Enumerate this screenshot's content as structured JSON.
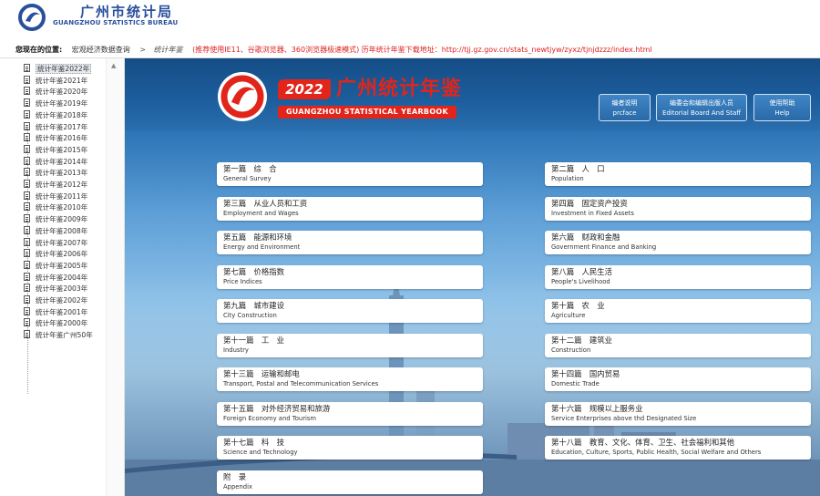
{
  "header": {
    "title": "广州市统计局",
    "subtitle": "GUANGZHOU STATISTICS BUREAU"
  },
  "breadcrumb": {
    "label": "您现在的位置:",
    "items": [
      "宏观经济数据查询",
      "统计年鉴"
    ],
    "separator": ">",
    "notice": "(推荐使用IE11、谷歌浏览器、360浏览器极速模式) 历年统计年鉴下载地址：http://tjj.gz.gov.cn/stats_newtjyw/zyxz/tjnjdzzz/index.html"
  },
  "sidebar": {
    "items": [
      {
        "label": "统计年鉴2022年",
        "selected": true
      },
      {
        "label": "统计年鉴2021年"
      },
      {
        "label": "统计年鉴2020年"
      },
      {
        "label": "统计年鉴2019年"
      },
      {
        "label": "统计年鉴2018年"
      },
      {
        "label": "统计年鉴2017年"
      },
      {
        "label": "统计年鉴2016年"
      },
      {
        "label": "统计年鉴2015年"
      },
      {
        "label": "统计年鉴2014年"
      },
      {
        "label": "统计年鉴2013年"
      },
      {
        "label": "统计年鉴2012年"
      },
      {
        "label": "统计年鉴2011年"
      },
      {
        "label": "统计年鉴2010年"
      },
      {
        "label": "统计年鉴2009年"
      },
      {
        "label": "统计年鉴2008年"
      },
      {
        "label": "统计年鉴2007年"
      },
      {
        "label": "统计年鉴2006年"
      },
      {
        "label": "统计年鉴2005年"
      },
      {
        "label": "统计年鉴2004年"
      },
      {
        "label": "统计年鉴2003年"
      },
      {
        "label": "统计年鉴2002年"
      },
      {
        "label": "统计年鉴2001年"
      },
      {
        "label": "统计年鉴2000年"
      },
      {
        "label": "统计年鉴广州50年"
      }
    ]
  },
  "banner": {
    "year": "2022",
    "title_cn": "广州统计年鉴",
    "title_en": "GUANGZHOU STATISTICAL YEARBOOK",
    "buttons": [
      {
        "cn": "编者说明",
        "en": "prcface"
      },
      {
        "cn": "编委会和编辑出版人员",
        "en": "Editorial Board And Staff"
      },
      {
        "cn": "使用帮助",
        "en": "Help"
      }
    ]
  },
  "categories": [
    {
      "cn": "第一篇　综　合",
      "en": "General Survey"
    },
    {
      "cn": "第二篇　人　口",
      "en": "Population"
    },
    {
      "cn": "第三篇　从业人员和工资",
      "en": "Employment and Wages"
    },
    {
      "cn": "第四篇　固定资产投资",
      "en": "Investment in Fixed Assets"
    },
    {
      "cn": "第五篇　能源和环境",
      "en": "Energy and Environment"
    },
    {
      "cn": "第六篇　财政和金融",
      "en": "Government Finance and Banking"
    },
    {
      "cn": "第七篇　价格指数",
      "en": "Price Indices"
    },
    {
      "cn": "第八篇　人民生活",
      "en": "People's Livelihood"
    },
    {
      "cn": "第九篇　城市建设",
      "en": "City Construction"
    },
    {
      "cn": "第十篇　农　业",
      "en": "Agriculture"
    },
    {
      "cn": "第十一篇　工　业",
      "en": "Industry"
    },
    {
      "cn": "第十二篇　建筑业",
      "en": "Construction"
    },
    {
      "cn": "第十三篇　运输和邮电",
      "en": "Transport, Postal and Telecommunication Services"
    },
    {
      "cn": "第十四篇　国内贸易",
      "en": "Domestic Trade"
    },
    {
      "cn": "第十五篇　对外经济贸易和旅游",
      "en": "Foreign Economy and Tourism"
    },
    {
      "cn": "第十六篇　规模以上服务业",
      "en": "Service Enterprises above thd Designated Size"
    },
    {
      "cn": "第十七篇　科　技",
      "en": "Science and Technology"
    },
    {
      "cn": "第十八篇　教育、文化、体育、卫生、社会福利和其他",
      "en": "Education, Culture, Sports, Public Health, Social Welfare and Others"
    },
    {
      "cn": "附　录",
      "en": "Appendix"
    }
  ],
  "colors": {
    "brand_blue": "#2a4f9b",
    "brand_red": "#e1251b",
    "banner_blue": "#1d5e9e"
  }
}
